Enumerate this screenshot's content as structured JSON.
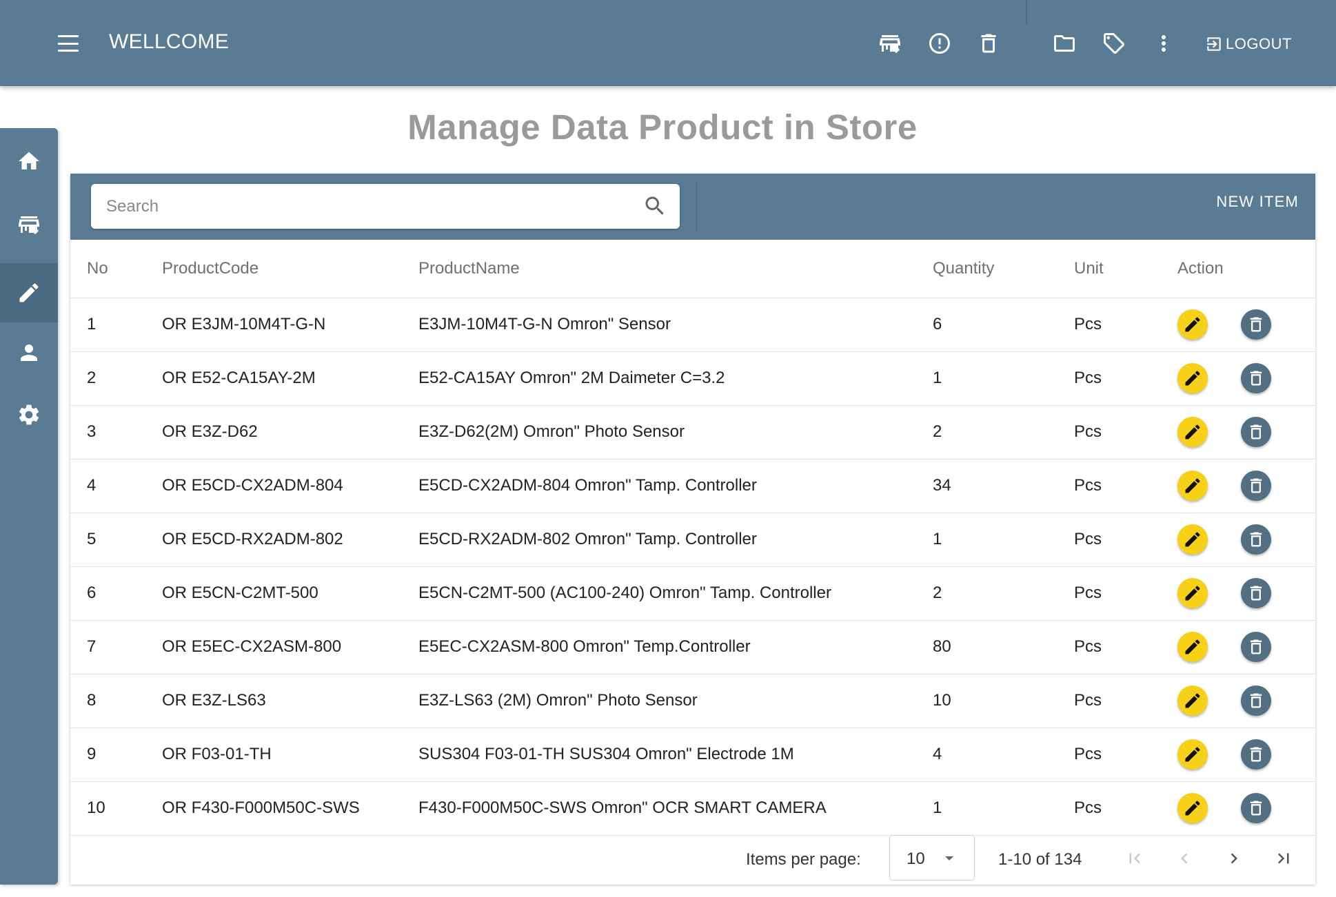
{
  "header": {
    "title": "WELLCOME",
    "logout_label": "LOGOUT",
    "icons": [
      "add-to-store-icon",
      "alert-icon",
      "delete-icon",
      "folder-icon",
      "tag-icon",
      "more-vert-icon"
    ]
  },
  "sidebar": {
    "items": [
      {
        "icon": "home-icon"
      },
      {
        "icon": "add-store-icon"
      },
      {
        "icon": "edit-icon",
        "active": true
      },
      {
        "icon": "person-icon"
      },
      {
        "icon": "settings-icon"
      }
    ]
  },
  "page": {
    "title": "Manage Data Product in Store"
  },
  "toolbar": {
    "search_placeholder": "Search",
    "search_value": "",
    "new_item_label": "NEW ITEM"
  },
  "table": {
    "columns": {
      "no": "No",
      "code": "ProductCode",
      "name": "ProductName",
      "qty": "Quantity",
      "unit": "Unit",
      "action": "Action"
    },
    "rows": [
      {
        "no": "1",
        "code": "OR E3JM-10M4T-G-N",
        "name": "E3JM-10M4T-G-N Omron\" Sensor",
        "qty": "6",
        "unit": "Pcs"
      },
      {
        "no": "2",
        "code": "OR E52-CA15AY-2M",
        "name": "E52-CA15AY Omron\" 2M Daimeter C=3.2",
        "qty": "1",
        "unit": "Pcs"
      },
      {
        "no": "3",
        "code": "OR E3Z-D62",
        "name": "E3Z-D62(2M) Omron\" Photo Sensor",
        "qty": "2",
        "unit": "Pcs"
      },
      {
        "no": "4",
        "code": "OR E5CD-CX2ADM-804",
        "name": "E5CD-CX2ADM-804 Omron\" Tamp. Controller",
        "qty": "34",
        "unit": "Pcs"
      },
      {
        "no": "5",
        "code": "OR E5CD-RX2ADM-802",
        "name": "E5CD-RX2ADM-802 Omron\" Tamp. Controller",
        "qty": "1",
        "unit": "Pcs"
      },
      {
        "no": "6",
        "code": "OR E5CN-C2MT-500",
        "name": "E5CN-C2MT-500 (AC100-240) Omron\" Tamp. Controller",
        "qty": "2",
        "unit": "Pcs"
      },
      {
        "no": "7",
        "code": "OR E5EC-CX2ASM-800",
        "name": "E5EC-CX2ASM-800 Omron\" Temp.Controller",
        "qty": "80",
        "unit": "Pcs"
      },
      {
        "no": "8",
        "code": "OR E3Z-LS63",
        "name": "E3Z-LS63 (2M) Omron\" Photo Sensor",
        "qty": "10",
        "unit": "Pcs"
      },
      {
        "no": "9",
        "code": "OR F03-01-TH",
        "name": "SUS304 F03-01-TH SUS304 Omron\" Electrode 1M",
        "qty": "4",
        "unit": "Pcs"
      },
      {
        "no": "10",
        "code": "OR F430-F000M50C-SWS",
        "name": "F430-F000M50C-SWS Omron\" OCR SMART CAMERA",
        "qty": "1",
        "unit": "Pcs"
      }
    ]
  },
  "paginator": {
    "items_per_page_label": "Items per page:",
    "page_size": "10",
    "range_label": "1-10 of 134"
  },
  "colors": {
    "primary": "#5a7b94",
    "edit_button": "#f7d117",
    "delete_button": "#526f84",
    "title_gray": "#9a9a9a"
  }
}
